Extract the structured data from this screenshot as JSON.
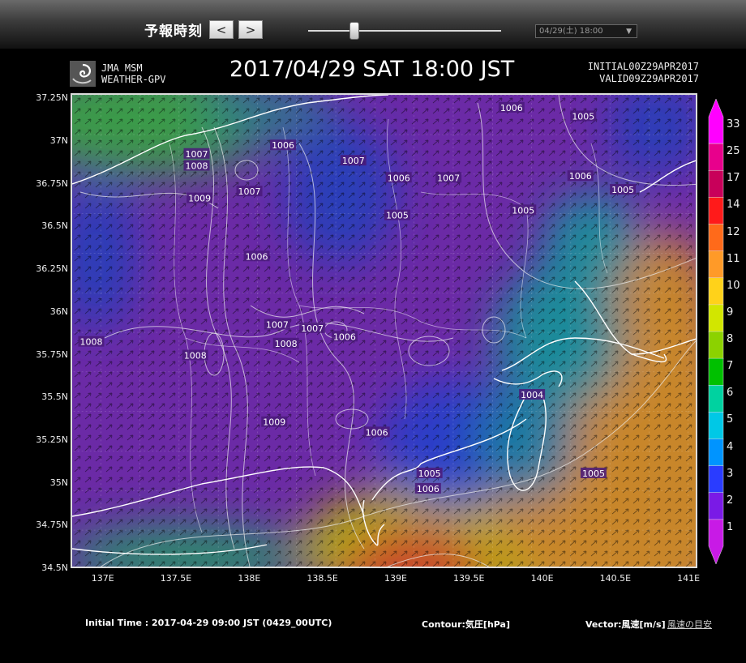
{
  "toolbar": {
    "label": "予報時刻",
    "prev": "<",
    "next": ">",
    "slider_value": 0.24,
    "time_select": "04/29(土) 18:00"
  },
  "header": {
    "logo_line1": "JMA MSM",
    "logo_line2": "WEATHER-GPV",
    "title": "2017/04/29  SAT  18:00 JST",
    "initial": "INITIAL00Z29APR2017",
    "valid": "VALID09Z29APR2017"
  },
  "map": {
    "lat_labels": [
      "37.25N",
      "37N",
      "36.75N",
      "36.5N",
      "36.25N",
      "36N",
      "35.75N",
      "35.5N",
      "35.25N",
      "35N",
      "34.75N",
      "34.5N"
    ],
    "lon_labels": [
      "137E",
      "137.5E",
      "138E",
      "138.5E",
      "139E",
      "139.5E",
      "140E",
      "140.5E",
      "141E"
    ],
    "pressure_labels": [
      {
        "text": "1006",
        "lon": 139.78,
        "lat": 37.2
      },
      {
        "text": "1005",
        "lon": 140.27,
        "lat": 37.15
      },
      {
        "text": "1007",
        "lon": 137.63,
        "lat": 36.93
      },
      {
        "text": "1006",
        "lon": 138.22,
        "lat": 36.98
      },
      {
        "text": "1008",
        "lon": 137.63,
        "lat": 36.86
      },
      {
        "text": "1007",
        "lon": 138.7,
        "lat": 36.89
      },
      {
        "text": "1006",
        "lon": 139.01,
        "lat": 36.79
      },
      {
        "text": "1007",
        "lon": 139.35,
        "lat": 36.79
      },
      {
        "text": "1006",
        "lon": 140.25,
        "lat": 36.8
      },
      {
        "text": "1009",
        "lon": 137.65,
        "lat": 36.67
      },
      {
        "text": "1007",
        "lon": 137.99,
        "lat": 36.71
      },
      {
        "text": "1005",
        "lon": 140.54,
        "lat": 36.72
      },
      {
        "text": "1005",
        "lon": 139.0,
        "lat": 36.57
      },
      {
        "text": "1005",
        "lon": 139.86,
        "lat": 36.6
      },
      {
        "text": "1006",
        "lon": 138.04,
        "lat": 36.33
      },
      {
        "text": "1008",
        "lon": 136.91,
        "lat": 35.83
      },
      {
        "text": "1007",
        "lon": 138.18,
        "lat": 35.93
      },
      {
        "text": "1007",
        "lon": 138.42,
        "lat": 35.91
      },
      {
        "text": "1006",
        "lon": 138.64,
        "lat": 35.86
      },
      {
        "text": "1008",
        "lon": 138.24,
        "lat": 35.82
      },
      {
        "text": "1008",
        "lon": 137.62,
        "lat": 35.75
      },
      {
        "text": "1004",
        "lon": 139.92,
        "lat": 35.52
      },
      {
        "text": "1009",
        "lon": 138.16,
        "lat": 35.36
      },
      {
        "text": "1006",
        "lon": 138.86,
        "lat": 35.3
      },
      {
        "text": "1005",
        "lon": 139.22,
        "lat": 35.06
      },
      {
        "text": "1005",
        "lon": 140.34,
        "lat": 35.06
      },
      {
        "text": "1006",
        "lon": 139.21,
        "lat": 34.97
      }
    ]
  },
  "colorbar": {
    "labels": [
      "33",
      "25",
      "17",
      "14",
      "12",
      "11",
      "10",
      "9",
      "8",
      "7",
      "6",
      "5",
      "4",
      "3",
      "2",
      "1"
    ],
    "colors": [
      "#ff00ff",
      "#e8008c",
      "#c8005a",
      "#ff1a1a",
      "#ff6a1a",
      "#ff9a28",
      "#ffd21a",
      "#d2e600",
      "#8cd200",
      "#00c000",
      "#00d2a0",
      "#00c8e6",
      "#0094ff",
      "#2a3cff",
      "#7a1ae6",
      "#c81ae6"
    ]
  },
  "footer": {
    "initial_time": "Initial Time : 2017-04-29 09:00 JST (0429_00UTC)",
    "contour": "Contour:気圧[hPa]",
    "vector": "Vector:風速[m/s]",
    "guide_link": "風速の目安"
  }
}
